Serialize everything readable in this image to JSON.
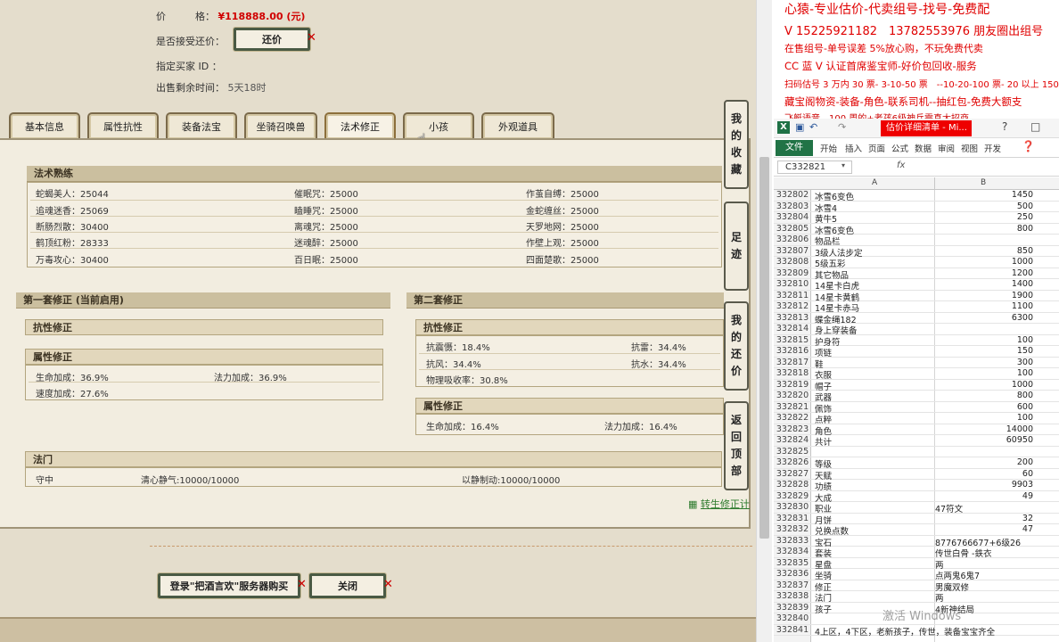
{
  "header": {
    "price_label": "价　　　格：",
    "price_value": "¥118888.00 (元)",
    "accept_offer_label": "是否接受还价：",
    "counter_offer_button": "还价",
    "buyer_id_label": "指定买家 ID ：",
    "time_left_label": "出售剩余时间：",
    "time_left_value": "5天18时"
  },
  "tabs": [
    {
      "label": "基本信息"
    },
    {
      "label": "属性抗性"
    },
    {
      "label": "装备法宝"
    },
    {
      "label": "坐骑召唤兽"
    },
    {
      "label": "法术修正"
    },
    {
      "label": "小孩"
    },
    {
      "label": "外观道具"
    }
  ],
  "active_tab": "法术修正",
  "spell_mastery": {
    "title": "法术熟练",
    "rows": [
      [
        "蛇蝎美人：25044",
        "催眠咒：25000",
        "作茧自缚：25000"
      ],
      [
        "追魂迷香：25069",
        "瞌睡咒：25000",
        "金蛇缠丝：25000"
      ],
      [
        "断肠烈散：30400",
        "离魂咒：25000",
        "天罗地网：25000"
      ],
      [
        "鹤顶红粉：28333",
        "迷魂醉：25000",
        "作壁上观：25000"
      ],
      [
        "万毒攻心：30400",
        "百日眠：25000",
        "四面楚歌：25000"
      ]
    ]
  },
  "correction_set_1": {
    "title": "第一套修正 (当前启用)",
    "resist_title": "抗性修正",
    "attr_title": "属性修正",
    "attr_rows": [
      [
        "生命加成：36.9%",
        "法力加成：36.9%"
      ],
      [
        "速度加成：27.6%",
        ""
      ]
    ]
  },
  "correction_set_2": {
    "title": "第二套修正",
    "resist_title": "抗性修正",
    "resist_rows": [
      [
        "抗震慑：18.4%",
        "抗雷：34.4%"
      ],
      [
        "抗风：34.4%",
        "抗水：34.4%"
      ],
      [
        "物理吸收率：30.8%",
        ""
      ]
    ],
    "attr_title": "属性修正",
    "attr_rows": [
      [
        "生命加成：16.4%",
        "法力加成：16.4%"
      ]
    ]
  },
  "school": {
    "title": "法门",
    "row": [
      "守中",
      "清心静气:10000/10000",
      "以静制动:10000/10000"
    ]
  },
  "rebirth_link": "转生修正计",
  "side_buttons": [
    {
      "label": "我的收藏",
      "chars": [
        "我",
        "的",
        "收",
        "藏"
      ]
    },
    {
      "label": "足迹",
      "chars": [
        "足",
        "迹"
      ]
    },
    {
      "label": "我的还价",
      "chars": [
        "我",
        "的",
        "还",
        "价"
      ]
    },
    {
      "label": "返回顶部",
      "chars": [
        "返",
        "回",
        "顶",
        "部"
      ]
    }
  ],
  "footer": {
    "login_buy_button": "登录\"把酒言欢\"服务器购买",
    "close_button": "关闭"
  },
  "ad_lines": [
    "心猿-专业估价-代卖组号-找号-免费配",
    "V 15225921182　13782553976 朋友圈出组号",
    "在售组号-单号误差 5%放心购，不玩免费代卖",
    "CC 蓝 V 认证首席鉴宝师-好价包回收-服务",
    "扫码估号 3 万内 30 票- 3-10-50 票　--10-20-100 票- 20 以上 150",
    "藏宝阁物资-装备-角色-联系司机--抽红包-免费大额支",
    "飞艇语音　100 周的+老孩6级神兵需真大招商"
  ],
  "excel": {
    "title": "估价详细清单 - Mi...",
    "ribbon_tabs": [
      "文件",
      "开始",
      "插入",
      "页面",
      "公式",
      "数据",
      "审阅",
      "视图",
      "开发"
    ],
    "name_box": "C332821",
    "fx": "fx",
    "col_a": "A",
    "col_b": "B",
    "rows": [
      [
        "332802",
        "冰雪6变色",
        "1450"
      ],
      [
        "332803",
        "冰雪4",
        "500"
      ],
      [
        "332804",
        "黄牛5",
        "250"
      ],
      [
        "332805",
        "冰雪6变色",
        "800"
      ],
      [
        "332806",
        "物品栏",
        ""
      ],
      [
        "332807",
        "3级人法步定",
        "850"
      ],
      [
        "332808",
        "5级五彩",
        "1000"
      ],
      [
        "332809",
        "其它物品",
        "1200"
      ],
      [
        "332810",
        "14星卡白虎",
        "1400"
      ],
      [
        "332811",
        "14星卡黄鹤",
        "1900"
      ],
      [
        "332812",
        "14星卡赤马",
        "1100"
      ],
      [
        "332813",
        "蝶金绳182",
        "6300"
      ],
      [
        "332814",
        "身上穿装备",
        ""
      ],
      [
        "332815",
        "护身符",
        "100"
      ],
      [
        "332816",
        "项链",
        "150"
      ],
      [
        "332817",
        "鞋",
        "300"
      ],
      [
        "332818",
        "衣服",
        "100"
      ],
      [
        "332819",
        "帽子",
        "1000"
      ],
      [
        "332820",
        "武器",
        "800"
      ],
      [
        "332821",
        "佩饰",
        "600"
      ],
      [
        "332822",
        "点粹",
        "100"
      ],
      [
        "332823",
        "角色",
        "14000"
      ],
      [
        "332824",
        "共计",
        "60950"
      ],
      [
        "332825",
        "",
        ""
      ],
      [
        "332826",
        "等级",
        "200"
      ],
      [
        "332827",
        "天赋",
        "60"
      ],
      [
        "332828",
        "功绩",
        "9903"
      ],
      [
        "332829",
        "大成",
        "49"
      ],
      [
        "332830",
        "职业",
        "47符文"
      ],
      [
        "332831",
        "月饼",
        "32"
      ],
      [
        "332832",
        "兑换点数",
        "47"
      ],
      [
        "332833",
        "宝石",
        "8776766677+6级26"
      ],
      [
        "332834",
        "套装",
        "传世白骨 -鉄衣"
      ],
      [
        "332835",
        "星盘",
        "两"
      ],
      [
        "332836",
        "坐骑",
        "点两鬼6鬼7"
      ],
      [
        "332837",
        "修正",
        "男魔双修"
      ],
      [
        "332838",
        "法门",
        "两"
      ],
      [
        "332839",
        "孩子",
        "4新神结局"
      ],
      [
        "332840",
        "",
        ""
      ],
      [
        "332841",
        "4上区，4下区，老新孩子，传世，装备宝宝齐全",
        ""
      ]
    ],
    "left_aligned_rows": [
      "332830",
      "332833",
      "332834",
      "332835",
      "332836",
      "332837",
      "332838",
      "332839"
    ],
    "watermark": "激活 Windows"
  }
}
